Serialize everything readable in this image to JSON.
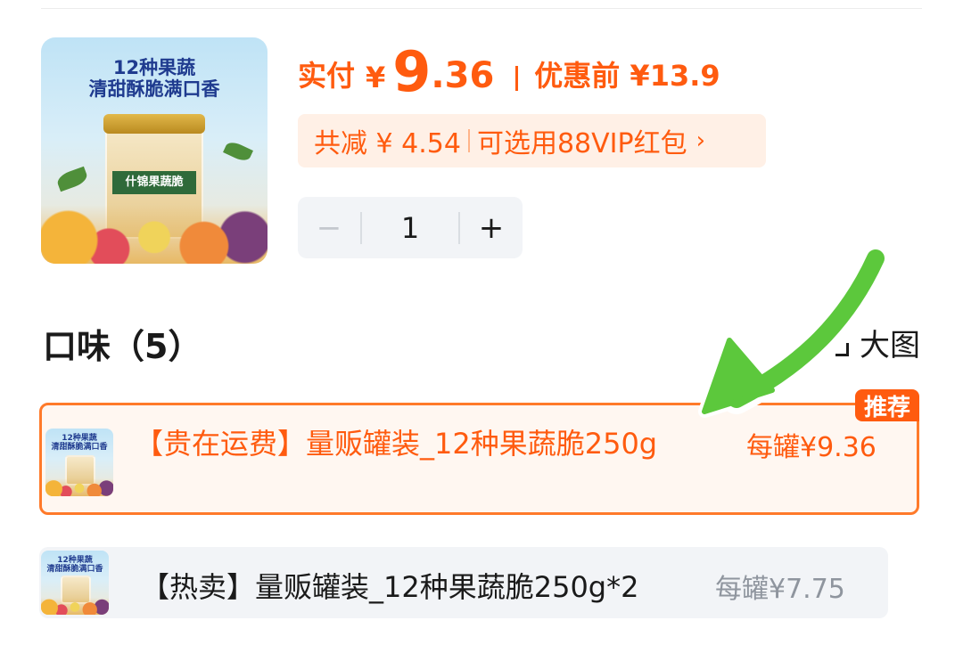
{
  "product": {
    "image_caption_line1": "12种果蔬",
    "image_caption_line2": "清甜酥脆满口香",
    "jar_label": "什锦果蔬脆"
  },
  "price": {
    "pay_label": "实付",
    "currency": "¥",
    "integer": "9",
    "decimal": ".36",
    "original_label": "优惠前 ¥13.9"
  },
  "discount": {
    "reduce_text": "共减 ¥ 4.54",
    "coupon_text": "可选用88VIP红包",
    "chevron": "›"
  },
  "stepper": {
    "minus": "−",
    "quantity": "1",
    "plus": "+"
  },
  "flavor_section": {
    "title": "口味（5）",
    "big_image_label": "大图"
  },
  "options": [
    {
      "label": "【贵在运费】量贩罐装_12种果蔬脆250g",
      "price": "每罐¥9.36",
      "badge": "推荐",
      "selected": true
    },
    {
      "label": "【热卖】量贩罐装_12种果蔬脆250g*2",
      "price": "每罐¥7.75",
      "selected": false
    }
  ],
  "colors": {
    "accent": "#ff5b0f",
    "annotation_arrow": "#5cc83c"
  }
}
